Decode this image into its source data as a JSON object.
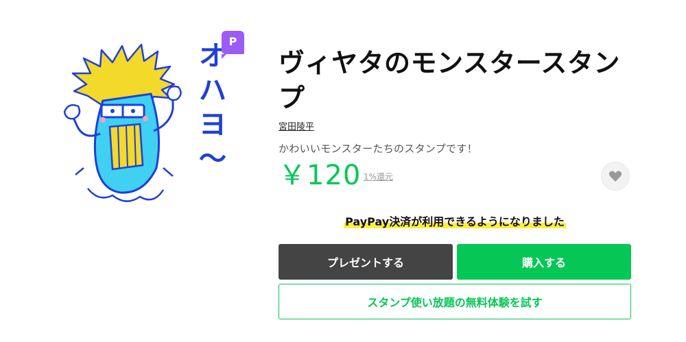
{
  "product": {
    "badge": "P",
    "title": "ヴィヤタのモンスタースタンプ",
    "author": "宮田陵平",
    "description": "かわいいモンスターたちのスタンプです！",
    "price": "￥120",
    "reward": "1%還元"
  },
  "sticker": {
    "icon": "monster-sticker-illustration",
    "text": "オハヨ〜",
    "colors": {
      "outline": "#1f3fd8",
      "body": "#3fd0f2",
      "hair": "#f2d92a",
      "text": "#1f3fd8",
      "blush": "#f4a1c6"
    }
  },
  "actions": {
    "favorite_icon": "heart-icon",
    "paypay_notice": "PayPay決済が利用できるようになりました",
    "present_label": "プレゼントする",
    "buy_label": "購入する",
    "trial_label": "スタンプ使い放題の無料体験を試す"
  },
  "colors": {
    "accent": "#06c755",
    "premium": "#9b5cf6",
    "present_button": "#444444",
    "highlight": "#ffef3a"
  }
}
